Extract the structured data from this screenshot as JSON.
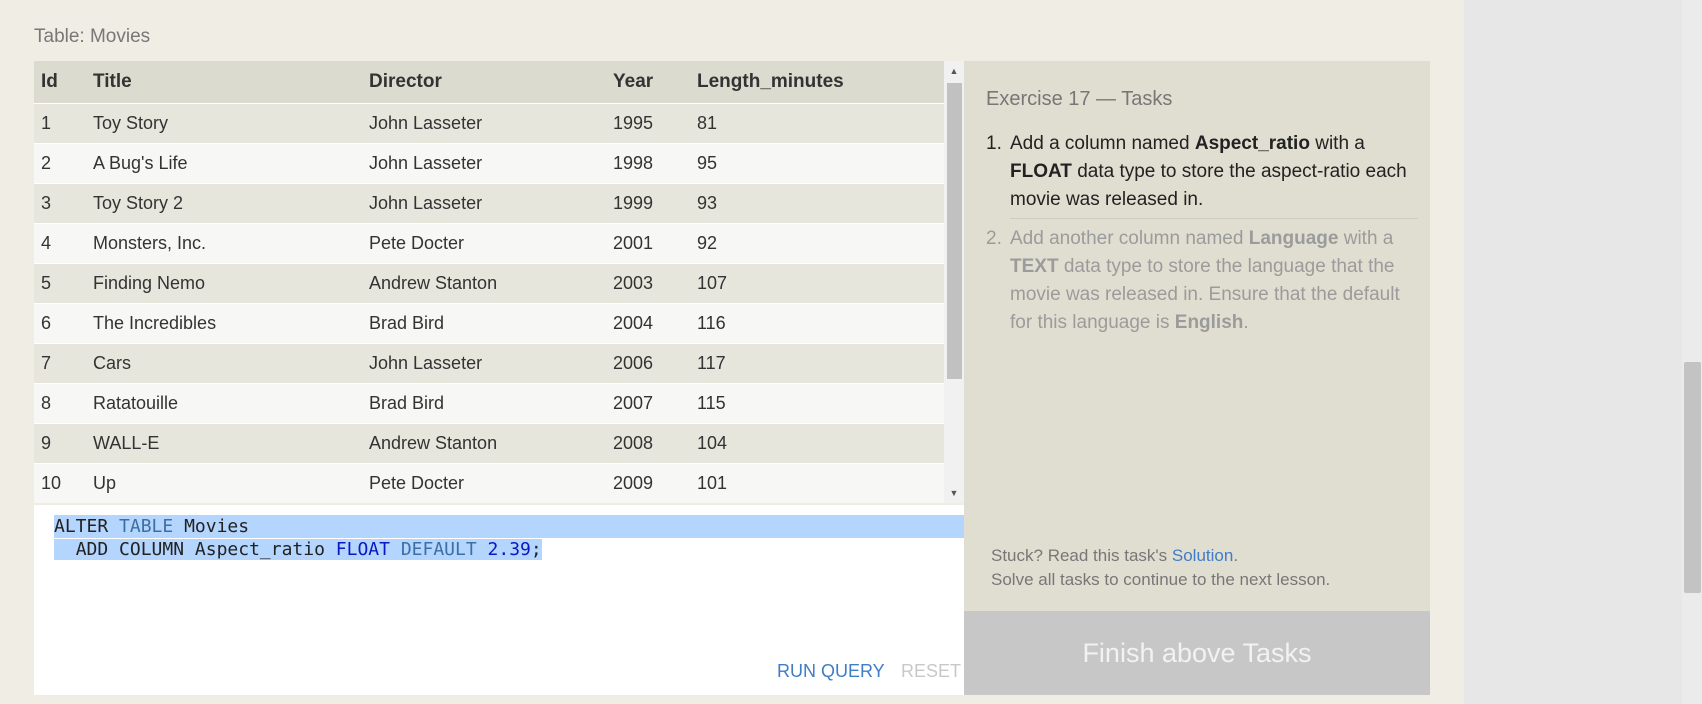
{
  "table": {
    "caption": "Table: Movies",
    "columns": [
      "Id",
      "Title",
      "Director",
      "Year",
      "Length_minutes"
    ],
    "rows": [
      [
        "1",
        "Toy Story",
        "John Lasseter",
        "1995",
        "81"
      ],
      [
        "2",
        "A Bug's Life",
        "John Lasseter",
        "1998",
        "95"
      ],
      [
        "3",
        "Toy Story 2",
        "John Lasseter",
        "1999",
        "93"
      ],
      [
        "4",
        "Monsters, Inc.",
        "Pete Docter",
        "2001",
        "92"
      ],
      [
        "5",
        "Finding Nemo",
        "Andrew Stanton",
        "2003",
        "107"
      ],
      [
        "6",
        "The Incredibles",
        "Brad Bird",
        "2004",
        "116"
      ],
      [
        "7",
        "Cars",
        "John Lasseter",
        "2006",
        "117"
      ],
      [
        "8",
        "Ratatouille",
        "Brad Bird",
        "2007",
        "115"
      ],
      [
        "9",
        "WALL-E",
        "Andrew Stanton",
        "2008",
        "104"
      ],
      [
        "10",
        "Up",
        "Pete Docter",
        "2009",
        "101"
      ]
    ]
  },
  "editor": {
    "line1": {
      "a": "ALTER",
      "b": "TABLE",
      "c": "Movies"
    },
    "line2": {
      "a": "ADD COLUMN Aspect_ratio",
      "b": "FLOAT",
      "c": "DEFAULT",
      "d": "2.39",
      "e": ";"
    },
    "run_label": "RUN QUERY",
    "reset_label": "RESET"
  },
  "tasks": {
    "title": "Exercise 17 — Tasks",
    "items": [
      {
        "num": "1.",
        "parts": [
          "Add a column named ",
          "Aspect_ratio",
          " with a ",
          "FLOAT",
          " data type to store the aspect-ratio each movie was released in."
        ]
      },
      {
        "num": "2.",
        "parts": [
          "Add another column named ",
          "Language",
          " with a ",
          "TEXT",
          " data type to store the language that the movie was released in. Ensure that the default for this language is ",
          "English",
          "."
        ]
      }
    ],
    "help": {
      "prefix": "Stuck? Read this task's ",
      "link": "Solution",
      "suffix": ".",
      "line2": "Solve all tasks to continue to the next lesson."
    },
    "finish_label": "Finish above Tasks"
  },
  "colors": {
    "accent_link": "#3f7dc6",
    "selection": "#b4d5fe",
    "panel": "#e0ded1",
    "finish_button": "#c7c7c7"
  },
  "icons": {
    "scroll_up": "triangle-up-icon",
    "scroll_down": "triangle-down-icon"
  }
}
